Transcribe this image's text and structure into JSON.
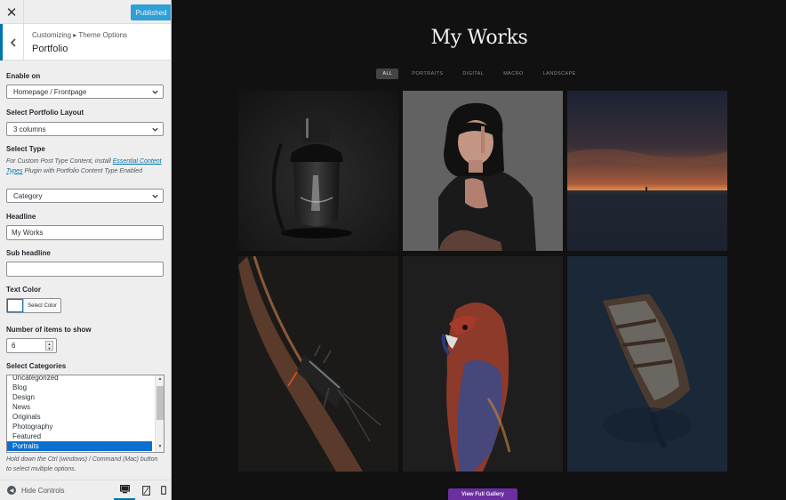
{
  "window": {
    "close_icon": "close-icon",
    "published_label": "Published"
  },
  "section": {
    "breadcrumb": "Customizing ▸ Theme Options",
    "title": "Portfolio"
  },
  "controls": {
    "enable_on": {
      "label": "Enable on",
      "value": "Homepage / Frontpage"
    },
    "layout": {
      "label": "Select Portfolio Layout",
      "value": "3 columns"
    },
    "type": {
      "label": "Select Type",
      "note_before": "For Custom Post Type Content, install ",
      "note_link": "Essential Content Types",
      "note_after": " Plugin with Portfolio Content Type Enabled",
      "value": "Category"
    },
    "headline": {
      "label": "Headline",
      "value": "My Works"
    },
    "sub_headline": {
      "label": "Sub headline",
      "value": ""
    },
    "text_color": {
      "label": "Text Color",
      "button_label": "Select Color",
      "swatch": "#ffffff"
    },
    "items_count": {
      "label": "Number of items to show",
      "value": "6"
    },
    "categories": {
      "label": "Select Categories",
      "options": [
        "Uncategorized",
        "Blog",
        "Design",
        "News",
        "Originals",
        "Photography",
        "Featured",
        "Portraits"
      ],
      "selected": "Portraits",
      "note": "Hold down the Ctrl (windows) / Command (Mac) button to select multiple options."
    }
  },
  "footer": {
    "hide_controls": "Hide Controls",
    "devices": [
      "desktop-icon",
      "tablet-icon",
      "mobile-icon"
    ]
  },
  "preview": {
    "title": "My Works",
    "filters": [
      "ALL",
      "PORTRAITS",
      "DIGITAL",
      "MACRO",
      "LANDSCAPE"
    ],
    "active_filter": "ALL",
    "tiles": [
      "lantern-photo",
      "portrait-photo",
      "sunset-sea-photo",
      "insect-on-branch-photo",
      "parrot-photo",
      "rowboat-photo"
    ],
    "gallery_button": "View Full Gallery"
  },
  "colors": {
    "accent_blue": "#0073aa",
    "published_blue": "#2f9fd6",
    "selected_option": "#0a6fcf",
    "gallery_purple": "#6b2fa0",
    "preview_bg": "#111111"
  }
}
